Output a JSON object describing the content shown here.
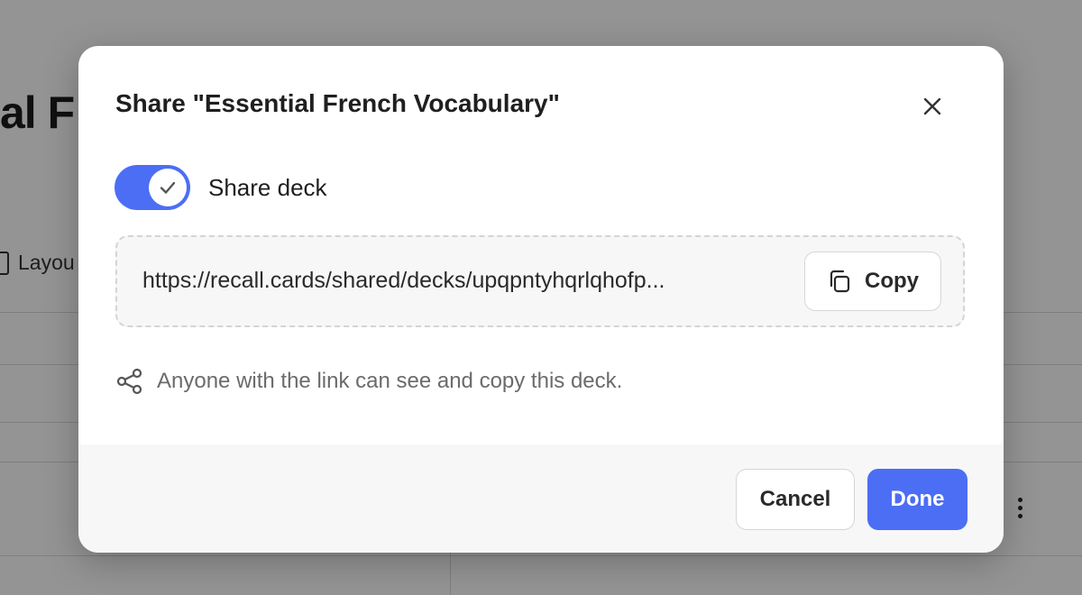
{
  "background": {
    "title_fragment": "al F",
    "layout_label_fragment": "Layou",
    "kebab_icon": "vertical-dots-icon"
  },
  "modal": {
    "title": "Share \"Essential French Vocabulary\"",
    "close_icon": "close-icon",
    "share_toggle": {
      "label": "Share deck",
      "checked": true
    },
    "share_link": {
      "url": "https://recall.cards/shared/decks/upqpntyhqrlqhofp...",
      "copy_label": "Copy",
      "copy_icon": "copy-icon"
    },
    "hint": {
      "icon": "share-icon",
      "text": "Anyone with the link can see and copy this deck."
    },
    "footer": {
      "cancel_label": "Cancel",
      "done_label": "Done"
    }
  },
  "colors": {
    "accent": "#4c6ef5",
    "overlay": "rgba(0,0,0,0.42)",
    "footer_bg": "#f7f7f7"
  }
}
